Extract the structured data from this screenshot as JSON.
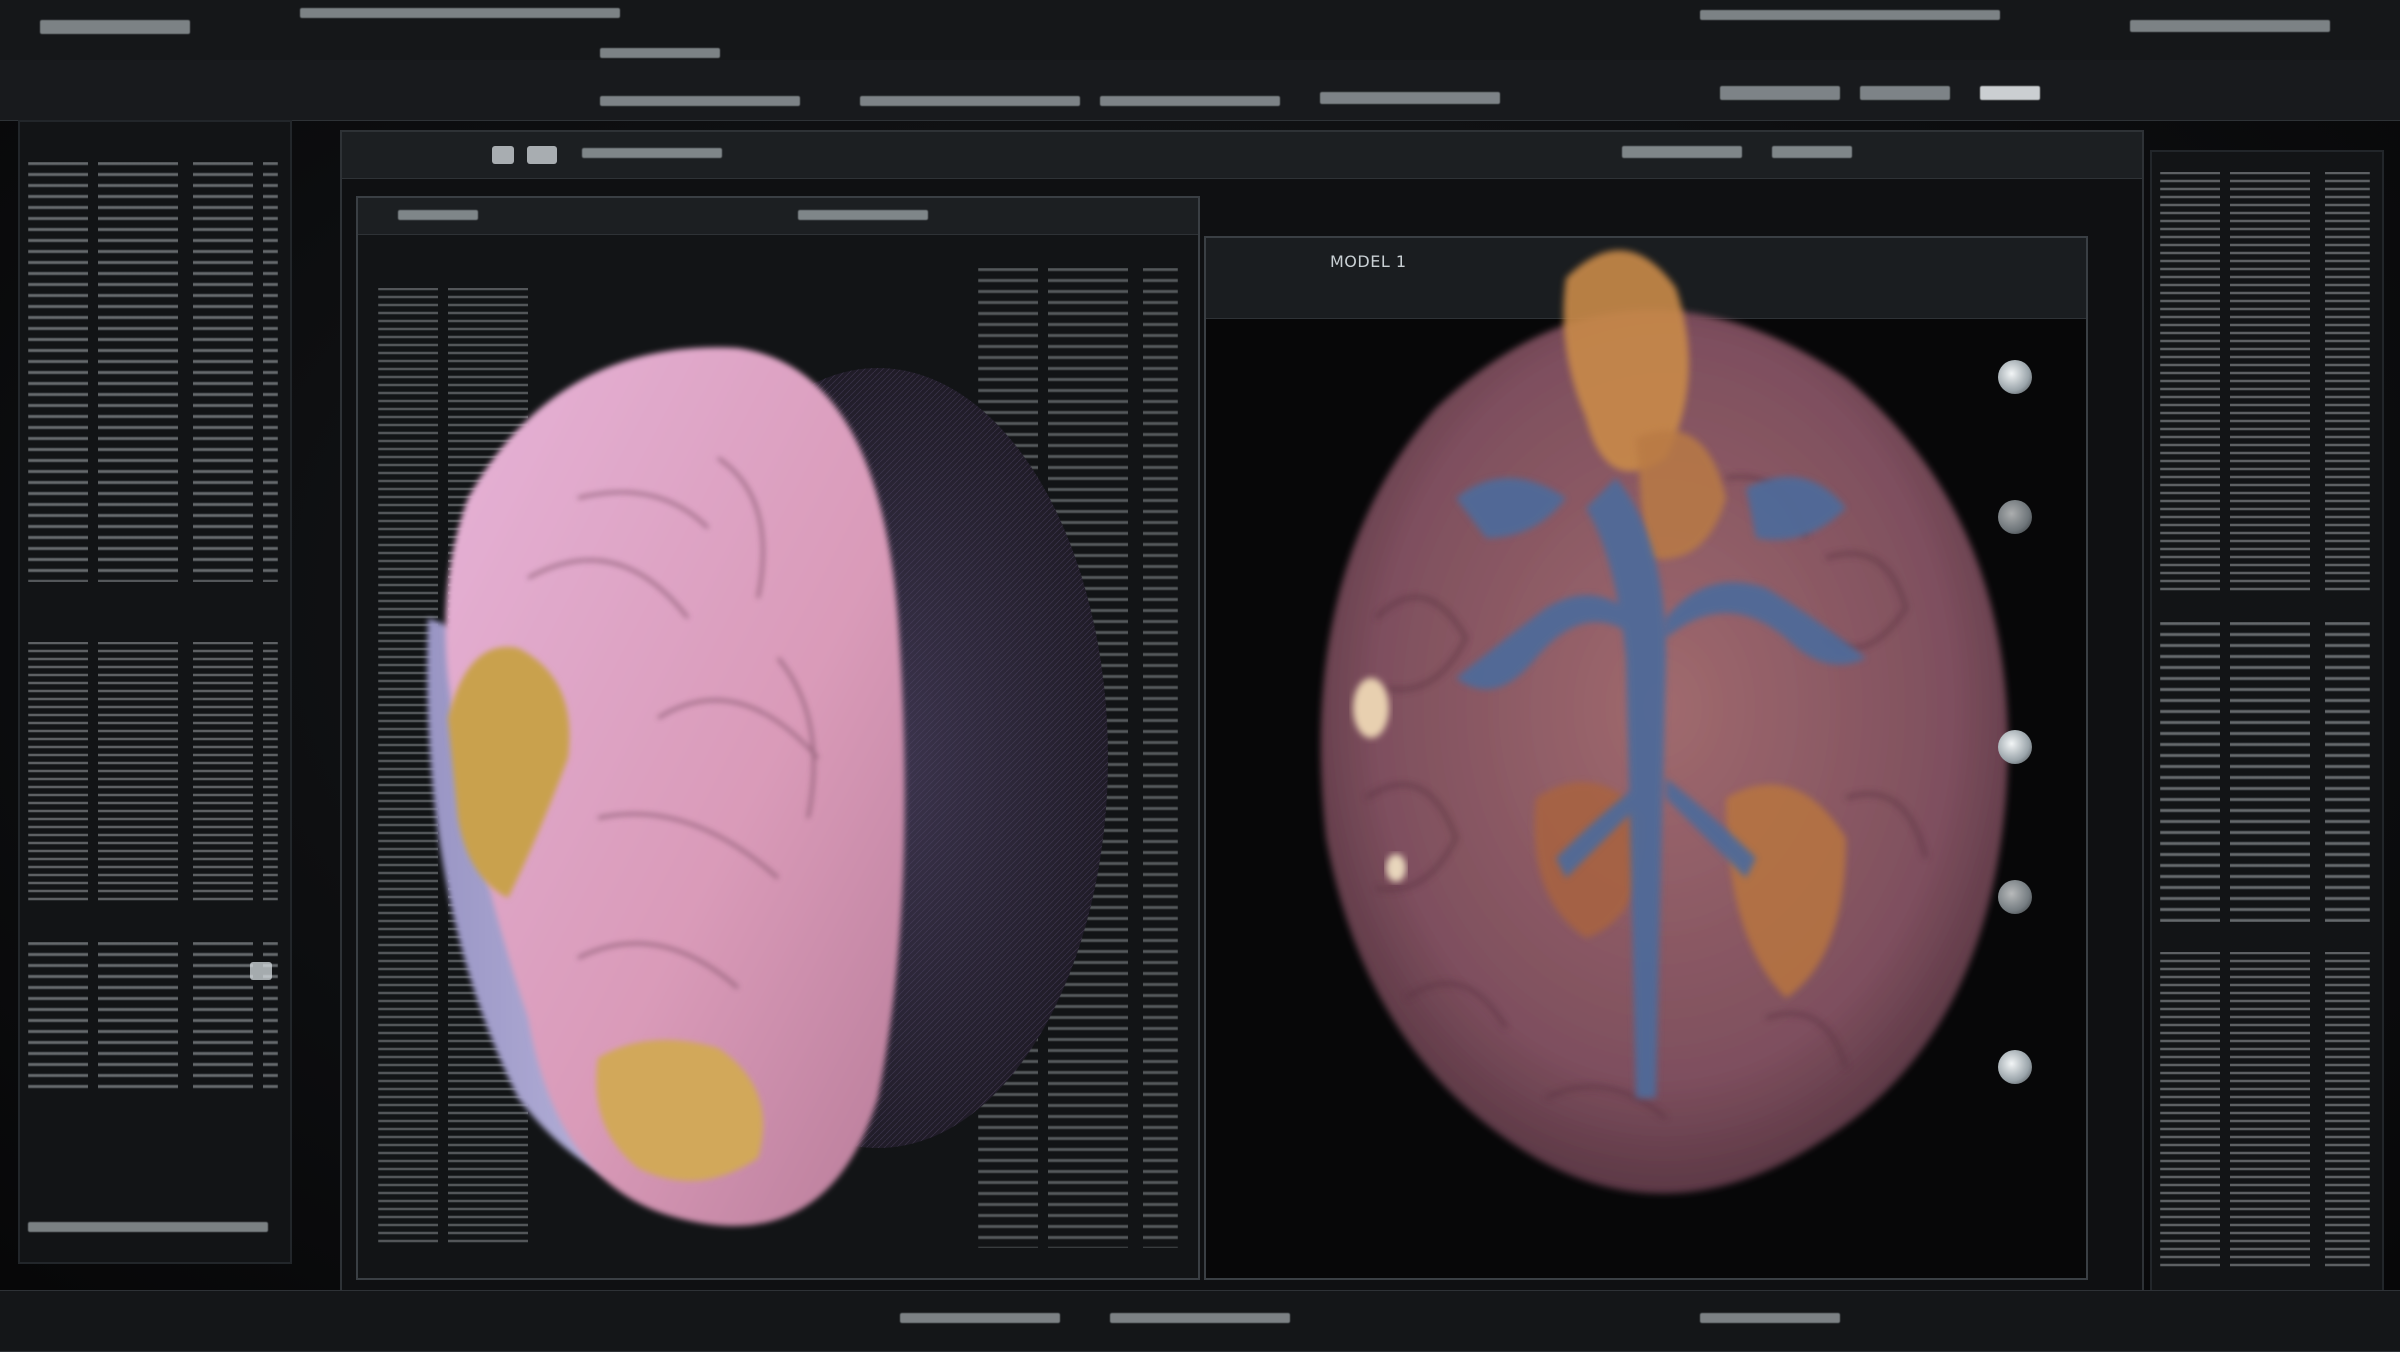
{
  "window": {
    "title": "",
    "menu_items": []
  },
  "viewports": {
    "left": {
      "view": "lateral-3d",
      "caption": ""
    },
    "right": {
      "view": "axial-section",
      "caption": "MODEL 1"
    }
  },
  "colors": {
    "background": "#0b0c0d",
    "panel": "#141618",
    "frame": "#2c3034",
    "brain_pink": "#d9a0c4",
    "brain_lavender": "#b7b2dc",
    "brain_gold": "#c9a14d",
    "section_tissue": "#8a5566",
    "section_blue": "#4f6a99",
    "section_orange": "#c98a4a"
  },
  "icons": [
    "toolbar-button-icon",
    "view-toggle-icon",
    "side-tool-icon"
  ]
}
